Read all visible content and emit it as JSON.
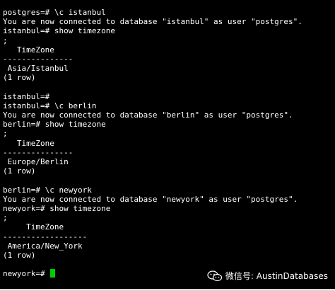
{
  "terminal": {
    "lines": [
      "postgres=# \\c istanbul",
      "You are now connected to database \"istanbul\" as user \"postgres\".",
      "istanbul=# show timezone",
      ";",
      "   TimeZone",
      "---------------",
      " Asia/Istanbul",
      "(1 row)",
      "",
      "istanbul=#",
      "istanbul=# \\c berlin",
      "You are now connected to database \"berlin\" as user \"postgres\".",
      "berlin=# show timezone",
      ";",
      "   TimeZone",
      "---------------",
      " Europe/Berlin",
      "(1 row)",
      "",
      "berlin=# \\c newyork",
      "You are now connected to database \"newyork\" as user \"postgres\".",
      "newyork=# show timezone",
      ";",
      "     TimeZone",
      "------------------",
      " America/New_York",
      "(1 row)",
      "",
      "newyork=# "
    ],
    "cursor_color": "#00cc00"
  },
  "watermark": {
    "text": "微信号: AustinDatabases",
    "icon": "wechat-icon"
  },
  "colors": {
    "background": "#000000",
    "foreground": "#ffffff"
  }
}
